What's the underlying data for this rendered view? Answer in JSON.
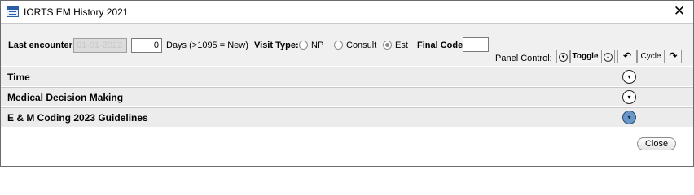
{
  "window": {
    "title": "IORTS EM History 2021"
  },
  "encounter": {
    "last_label": "Last encounter:",
    "last_value": "01-01-2022",
    "days_value": "0",
    "days_hint": "Days (>1095 = New)"
  },
  "visit_type": {
    "label": "Visit Type:",
    "options": [
      {
        "label": "NP",
        "checked": false
      },
      {
        "label": "Consult",
        "checked": false
      },
      {
        "label": "Est",
        "checked": true
      }
    ]
  },
  "final_code": {
    "label": "Final Code:",
    "value": ""
  },
  "panel_control": {
    "label": "Panel Control:",
    "toggle_label": "Toggle",
    "cycle_label": "Cycle",
    "glyphs": {
      "down": "▾",
      "up": "▴",
      "ccw": "↶",
      "cw": "↷"
    }
  },
  "sections": [
    {
      "title": "Time",
      "expand_glyph": "▾"
    },
    {
      "title": "Medical Decision Making",
      "expand_glyph": "▾"
    },
    {
      "title": "E & M Coding 2023 Guidelines",
      "expand_glyph": "▾"
    }
  ],
  "footer": {
    "close_label": "Close"
  },
  "icons": {
    "window_close": "✕"
  },
  "colors": {
    "active_expand": "#6a97c9"
  }
}
